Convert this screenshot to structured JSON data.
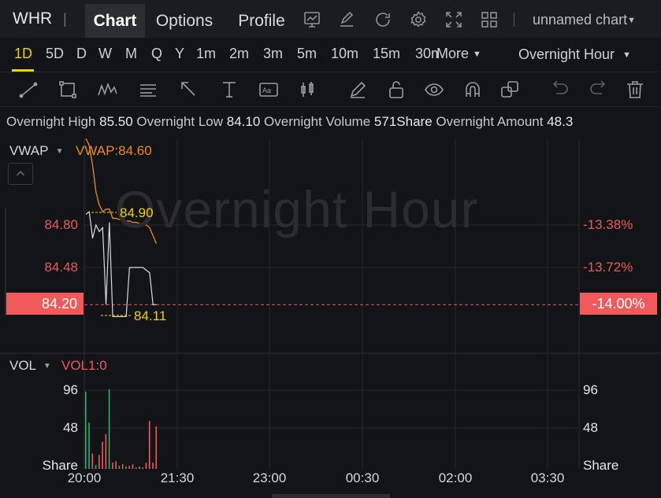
{
  "header": {
    "ticker": "WHR",
    "ticker_sep": "|",
    "tabs": [
      {
        "label": "Chart",
        "active": true
      },
      {
        "label": "Options",
        "active": false
      },
      {
        "label": "Profile",
        "active": false
      }
    ],
    "icons": [
      "indicator-chart-icon",
      "edit-icon",
      "refresh-icon",
      "settings-icon",
      "fullscreen-icon",
      "layout-grid-icon"
    ],
    "chart_name": "unnamed chart"
  },
  "intervals": {
    "items": [
      "1D",
      "5D",
      "D",
      "W",
      "M",
      "Q",
      "Y",
      "1m",
      "2m",
      "3m",
      "5m",
      "10m",
      "15m",
      "30m"
    ],
    "active": "1D",
    "more_label": "More",
    "session": "Overnight Hour"
  },
  "drawing_tools": [
    "line-tool-icon",
    "rectangle-tool-icon",
    "pattern-tool-icon",
    "fib-tool-icon",
    "arrow-tool-icon",
    "measure-tool-icon",
    "text-tool-icon",
    "candle-tool-icon",
    "pen-tool-icon",
    "unlock-icon",
    "eye-icon",
    "magnet-icon",
    "layers-icon",
    "undo-icon",
    "redo-icon",
    "trash-icon"
  ],
  "info": {
    "high_label": "Overnight High",
    "high_value": "85.50",
    "low_label": "Overnight Low",
    "low_value": "84.10",
    "volume_label": "Overnight Volume",
    "volume_value": "571Share",
    "amount_label": "Overnight Amount",
    "amount_value": "48.3"
  },
  "main_pane": {
    "legend": "VWAP",
    "vwap_value": "VWAP:84.60",
    "watermark": "Overnight Hour",
    "y_left": [
      "84.80",
      "84.48"
    ],
    "y_right": [
      "-13.38%",
      "-13.72%"
    ],
    "current_price": "84.20",
    "current_pct": "-14.00%",
    "high_anno": "84.90",
    "low_anno": "84.11"
  },
  "volume_pane": {
    "legend": "VOL",
    "vol_value": "VOL1:0",
    "y_left": [
      "96",
      "48",
      "Share"
    ],
    "y_right": [
      "96",
      "48",
      "Share"
    ]
  },
  "x_axis": [
    "20:00",
    "21:30",
    "23:00",
    "00:30",
    "02:00",
    "03:30"
  ],
  "colors": {
    "background": "#131417",
    "up": "#22b573",
    "down": "#f05a5a",
    "vwap": "#f08a1c",
    "accent": "#f0d200",
    "price_line": "#d9d9d9"
  },
  "chart_data": {
    "type": "line",
    "x_ticks": [
      "20:00",
      "21:30",
      "23:00",
      "00:30",
      "02:00",
      "03:30"
    ],
    "price_series": {
      "name": "",
      "points": [
        [
          0,
          84.88
        ],
        [
          1,
          84.9
        ],
        [
          2,
          84.7
        ],
        [
          3,
          84.8
        ],
        [
          4,
          84.75
        ],
        [
          5,
          84.78
        ],
        [
          6,
          84.2
        ],
        [
          7,
          84.82
        ],
        [
          8,
          84.11
        ],
        [
          9,
          84.11
        ],
        [
          10,
          84.11
        ],
        [
          11,
          84.11
        ],
        [
          12,
          84.11
        ],
        [
          13,
          84.48
        ],
        [
          14,
          84.48
        ],
        [
          15,
          84.48
        ],
        [
          16,
          84.48
        ],
        [
          17,
          84.48
        ],
        [
          18,
          84.46
        ],
        [
          19,
          84.44
        ],
        [
          20,
          84.2
        ],
        [
          21,
          84.2
        ]
      ]
    },
    "vwap_series": {
      "name": "VWAP",
      "points": [
        [
          0,
          85.5
        ],
        [
          1,
          85.4
        ],
        [
          2,
          85.25
        ],
        [
          3,
          85.05
        ],
        [
          4,
          84.95
        ],
        [
          5,
          84.9
        ],
        [
          6,
          84.92
        ],
        [
          7,
          84.92
        ],
        [
          8,
          84.85
        ],
        [
          9,
          84.85
        ],
        [
          10,
          84.84
        ],
        [
          11,
          84.84
        ],
        [
          12,
          84.83
        ],
        [
          13,
          84.83
        ],
        [
          14,
          84.82
        ],
        [
          15,
          84.82
        ],
        [
          16,
          84.81
        ],
        [
          17,
          84.81
        ],
        [
          18,
          84.8
        ],
        [
          19,
          84.78
        ],
        [
          20,
          84.72
        ],
        [
          21,
          84.66
        ]
      ]
    },
    "volume_series": {
      "name": "VOL",
      "bars": [
        {
          "x": 0,
          "v": 100,
          "c": "up"
        },
        {
          "x": 1,
          "v": 60,
          "c": "up"
        },
        {
          "x": 2,
          "v": 20,
          "c": "down"
        },
        {
          "x": 3,
          "v": 5,
          "c": "up"
        },
        {
          "x": 4,
          "v": 18,
          "c": "down"
        },
        {
          "x": 5,
          "v": 35,
          "c": "down"
        },
        {
          "x": 6,
          "v": 45,
          "c": "down"
        },
        {
          "x": 7,
          "v": 103,
          "c": "up"
        },
        {
          "x": 8,
          "v": 8,
          "c": "down"
        },
        {
          "x": 9,
          "v": 10,
          "c": "down"
        },
        {
          "x": 10,
          "v": 4,
          "c": "up"
        },
        {
          "x": 11,
          "v": 6,
          "c": "down"
        },
        {
          "x": 12,
          "v": 3,
          "c": "up"
        },
        {
          "x": 13,
          "v": 4,
          "c": "down"
        },
        {
          "x": 14,
          "v": 6,
          "c": "down"
        },
        {
          "x": 15,
          "v": 2,
          "c": "up"
        },
        {
          "x": 16,
          "v": 3,
          "c": "down"
        },
        {
          "x": 17,
          "v": 2,
          "c": "down"
        },
        {
          "x": 18,
          "v": 8,
          "c": "down"
        },
        {
          "x": 19,
          "v": 62,
          "c": "down"
        },
        {
          "x": 20,
          "v": 8,
          "c": "down"
        },
        {
          "x": 21,
          "v": 55,
          "c": "down"
        }
      ]
    },
    "price_ylim": [
      84.05,
      85.55
    ],
    "volume_ylim": [
      0,
      110
    ],
    "grid": true
  }
}
